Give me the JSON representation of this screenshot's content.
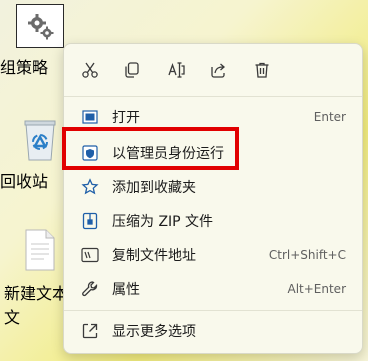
{
  "desktop": {
    "items": [
      {
        "label": "组策略"
      },
      {
        "label": "回收站"
      },
      {
        "label": "新建文本文"
      }
    ]
  },
  "toolbar": {
    "icons": [
      "scissors-icon",
      "copy-icon",
      "rename-icon",
      "share-icon",
      "delete-icon"
    ]
  },
  "menu": {
    "items": [
      {
        "label": "打开",
        "shortcut": "Enter",
        "icon": "open-icon"
      },
      {
        "label": "以管理员身份运行",
        "shortcut": "",
        "icon": "shield-icon"
      },
      {
        "label": "添加到收藏夹",
        "shortcut": "",
        "icon": "star-icon"
      },
      {
        "label": "压缩为 ZIP 文件",
        "shortcut": "",
        "icon": "zip-icon"
      },
      {
        "label": "复制文件地址",
        "shortcut": "Ctrl+Shift+C",
        "icon": "copy-path-icon"
      },
      {
        "label": "属性",
        "shortcut": "Alt+Enter",
        "icon": "wrench-icon"
      }
    ],
    "more": {
      "label": "显示更多选项",
      "icon": "more-options-icon"
    }
  },
  "colors": {
    "accent": "#0a64c8",
    "highlight": "#e10000"
  }
}
